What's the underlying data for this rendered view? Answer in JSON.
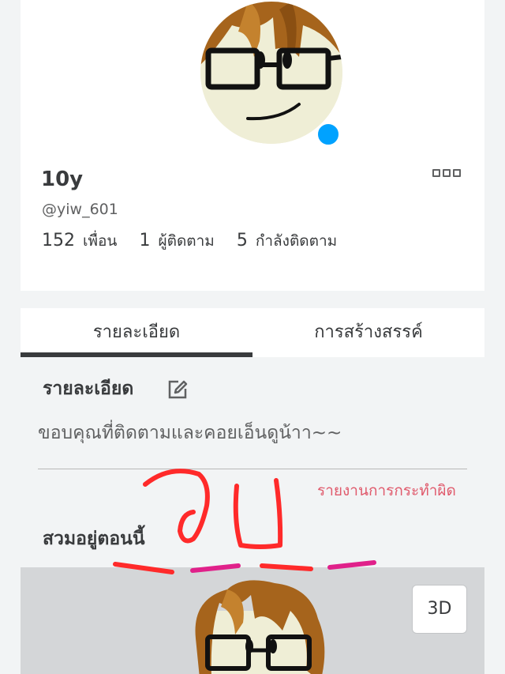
{
  "profile": {
    "display_name": "10y",
    "username": "@yiw_601",
    "online_color": "#00a2ff",
    "stats": [
      {
        "count": "152",
        "label": "เพื่อน"
      },
      {
        "count": "1",
        "label": "ผู้ติดตาม"
      },
      {
        "count": "5",
        "label": "กำลังติดตาม"
      }
    ],
    "more_icon": "more-options-icon"
  },
  "tabs": [
    {
      "label": "รายละเอียด",
      "active": true
    },
    {
      "label": "การสร้างสรรค์",
      "active": false
    }
  ],
  "about": {
    "heading": "รายละเอียด",
    "description": "ขอบคุณที่ติดตามและคอยเอ็นดูน้าา~~",
    "report_link": "รายงานการกระทำผิด",
    "edit_icon": "edit-pencil-icon"
  },
  "currently_wearing": {
    "heading": "สวมอยู่ตอนนี้",
    "view_3d_label": "3D"
  },
  "overlay": {
    "handwritten_text": "จบ",
    "ink_colors": [
      "#ff2a2a",
      "#e0218a"
    ]
  }
}
